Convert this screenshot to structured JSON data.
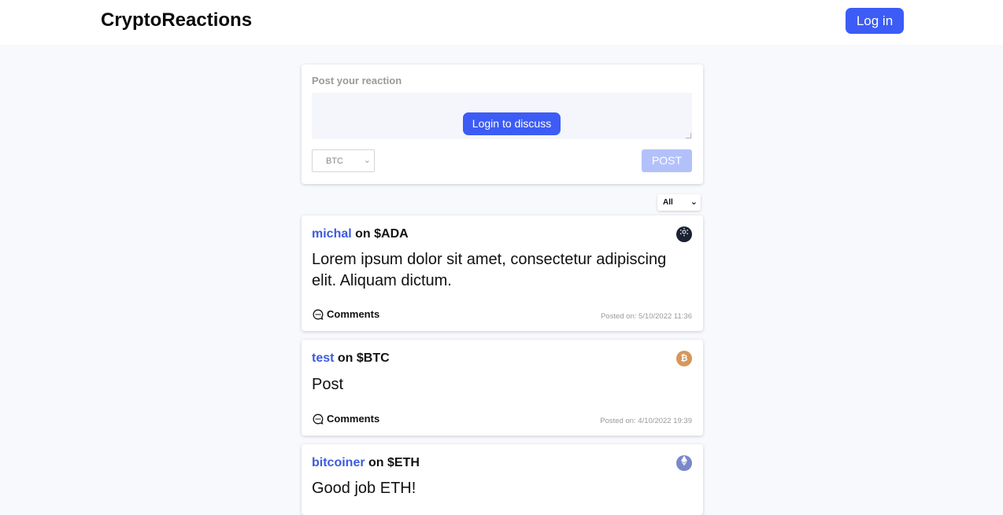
{
  "header": {
    "brand": "CryptoReactions",
    "login_label": "Log in"
  },
  "composer": {
    "label": "Post your reaction",
    "login_to_discuss": "Login to discuss",
    "selected_coin": "BTC",
    "post_label": "POST"
  },
  "filter": {
    "selected": "All"
  },
  "posts": [
    {
      "author": "michal",
      "connector": " on ",
      "coin": "$ADA",
      "coin_icon": "ada-icon",
      "body": "Lorem ipsum dolor sit amet, consectetur adipiscing elit. Aliquam dictum.",
      "comments_label": "Comments",
      "posted": "Posted on: 5/10/2022 11:36"
    },
    {
      "author": "test",
      "connector": " on ",
      "coin": "$BTC",
      "coin_icon": "btc-icon",
      "body": "Post",
      "comments_label": "Comments",
      "posted": "Posted on: 4/10/2022 19:39"
    },
    {
      "author": "bitcoiner",
      "connector": " on ",
      "coin": "$ETH",
      "coin_icon": "eth-icon",
      "body": "Good job ETH!"
    }
  ],
  "colors": {
    "accent": "#3c5cf5",
    "author_link": "#3d5bdc",
    "post_disabled": "#b3c1fb",
    "page_bg": "#f8f9fd"
  }
}
